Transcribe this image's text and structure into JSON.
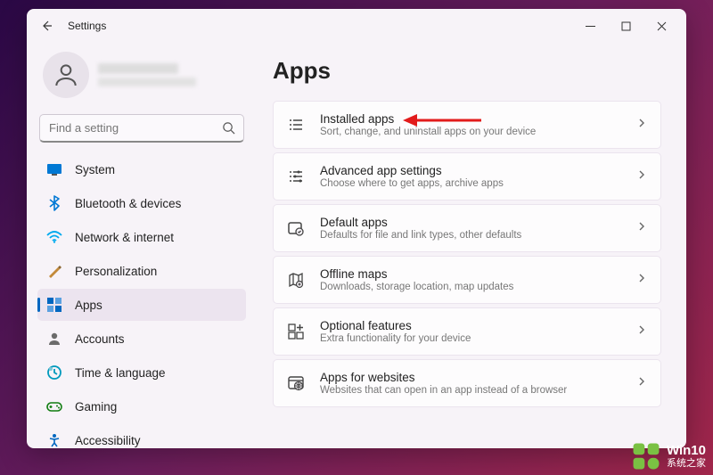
{
  "window": {
    "title": "Settings"
  },
  "search": {
    "placeholder": "Find a setting"
  },
  "nav": [
    {
      "id": "system",
      "label": "System",
      "icon": "system",
      "color": "#0078d4"
    },
    {
      "id": "bluetooth",
      "label": "Bluetooth & devices",
      "icon": "bluetooth",
      "color": "#0078d4"
    },
    {
      "id": "network",
      "label": "Network & internet",
      "icon": "network",
      "color": "#00aaee"
    },
    {
      "id": "personalization",
      "label": "Personalization",
      "icon": "personalization",
      "color": "#c38a3a"
    },
    {
      "id": "apps",
      "label": "Apps",
      "icon": "apps",
      "color": "#0067c0",
      "active": true
    },
    {
      "id": "accounts",
      "label": "Accounts",
      "icon": "accounts",
      "color": "#6b6b6b"
    },
    {
      "id": "time",
      "label": "Time & language",
      "icon": "time",
      "color": "#0099bc"
    },
    {
      "id": "gaming",
      "label": "Gaming",
      "icon": "gaming",
      "color": "#107c10"
    },
    {
      "id": "accessibility",
      "label": "Accessibility",
      "icon": "accessibility",
      "color": "#0067c0"
    }
  ],
  "page": {
    "title": "Apps"
  },
  "cards": [
    {
      "id": "installed",
      "title": "Installed apps",
      "sub": "Sort, change, and uninstall apps on your device",
      "icon": "list"
    },
    {
      "id": "advanced",
      "title": "Advanced app settings",
      "sub": "Choose where to get apps, archive apps",
      "icon": "sliders"
    },
    {
      "id": "default",
      "title": "Default apps",
      "sub": "Defaults for file and link types, other defaults",
      "icon": "default"
    },
    {
      "id": "offline",
      "title": "Offline maps",
      "sub": "Downloads, storage location, map updates",
      "icon": "map"
    },
    {
      "id": "optional",
      "title": "Optional features",
      "sub": "Extra functionality for your device",
      "icon": "plus-grid"
    },
    {
      "id": "websites",
      "title": "Apps for websites",
      "sub": "Websites that can open in an app instead of a browser",
      "icon": "web"
    }
  ],
  "watermark": {
    "line1": "Win10",
    "line2": "系统之家"
  }
}
